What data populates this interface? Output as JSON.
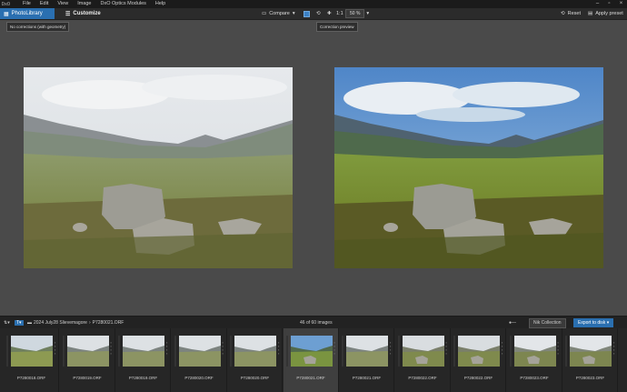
{
  "menubar": {
    "logo": "DxO",
    "items": [
      "File",
      "Edit",
      "View",
      "Image",
      "DxO Optics Modules",
      "Help"
    ]
  },
  "toolbar": {
    "tab_library": "PhotoLibrary",
    "tab_customize": "Customize",
    "compare": "Compare",
    "zoom_fit": "1:1",
    "zoom_level": "50 %",
    "reset": "Reset",
    "apply_preset": "Apply preset"
  },
  "viewer": {
    "left_caption": "No corrections (with geometry)",
    "right_caption": "Correction preview"
  },
  "browser": {
    "path_folder": "2024 July28 Slievemagore",
    "path_file": "P7280021.ORF",
    "count": "46 of 60 images",
    "nik": "Nik Collection",
    "export": "Export to disk"
  },
  "filmstrip": [
    {
      "label": "P7280018.ORF",
      "variant": "a"
    },
    {
      "label": "P7280019.ORF",
      "variant": "b"
    },
    {
      "label": "P7280019.ORF",
      "variant": "b"
    },
    {
      "label": "P7280020.ORF",
      "variant": "b"
    },
    {
      "label": "P7280020.ORF",
      "variant": "b"
    },
    {
      "label": "P7280021.ORF",
      "variant": "c"
    },
    {
      "label": "P7280021.ORF",
      "variant": "b"
    },
    {
      "label": "P7280022.ORF",
      "variant": "d"
    },
    {
      "label": "P7280022.ORF",
      "variant": "d"
    },
    {
      "label": "P7280023.ORF",
      "variant": "e"
    },
    {
      "label": "P7280023.ORF",
      "variant": "e"
    }
  ]
}
